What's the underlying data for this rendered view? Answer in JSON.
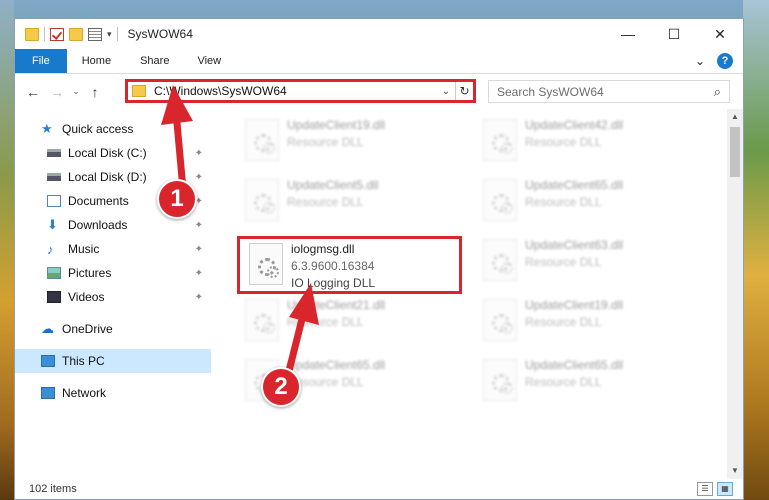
{
  "window": {
    "title": "SysWOW64",
    "minimize": "—",
    "maximize": "☐",
    "close": "✕"
  },
  "ribbon": {
    "tabs": [
      "File",
      "Home",
      "Share",
      "View"
    ],
    "expand_icon": "⌄",
    "help_icon": "?"
  },
  "address": {
    "back": "←",
    "forward": "→",
    "recent": "⌄",
    "up": "↑",
    "path": "C:\\Windows\\SysWOW64",
    "dropdown": "⌄",
    "refresh": "↻"
  },
  "search": {
    "placeholder": "Search SysWOW64",
    "icon": "⌕"
  },
  "nav": {
    "quick_access": "Quick access",
    "items": [
      {
        "label": "Local Disk (C:)",
        "icon": "disk-icon"
      },
      {
        "label": "Local Disk (D:)",
        "icon": "disk-icon"
      },
      {
        "label": "Documents",
        "icon": "documents-icon"
      },
      {
        "label": "Downloads",
        "icon": "downloads-icon"
      },
      {
        "label": "Music",
        "icon": "music-icon"
      },
      {
        "label": "Pictures",
        "icon": "pictures-icon"
      },
      {
        "label": "Videos",
        "icon": "videos-icon"
      }
    ],
    "onedrive": "OneDrive",
    "this_pc": "This PC",
    "network": "Network",
    "pin_glyph": "📌"
  },
  "files": {
    "highlighted": {
      "name": "iologmsg.dll",
      "version": "6.3.9600.16384",
      "description": "IO Logging DLL"
    },
    "blurred": [
      {
        "name": "UpdateClient19.dll",
        "sub": "Resource DLL"
      },
      {
        "name": "UpdateClient42.dll",
        "sub": "Resource DLL"
      },
      {
        "name": "UpdateClient5.dll",
        "sub": "Resource DLL"
      },
      {
        "name": "UpdateClient65.dll",
        "sub": "Resource DLL"
      },
      {
        "name": "UpdateClient63.dll",
        "sub": "Resource DLL"
      },
      {
        "name": "UpdateClient21.dll",
        "sub": "Resource DLL"
      },
      {
        "name": "UpdateClient19.dll",
        "sub": "Resource DLL"
      },
      {
        "name": "UpdateClient65.dll",
        "sub": "Resource DLL"
      },
      {
        "name": "UpdateClient65.dll",
        "sub": "Resource DLL"
      }
    ]
  },
  "status": {
    "count": "102 items"
  },
  "annotations": {
    "step1": "1",
    "step2": "2",
    "accent": "#d9262c"
  }
}
